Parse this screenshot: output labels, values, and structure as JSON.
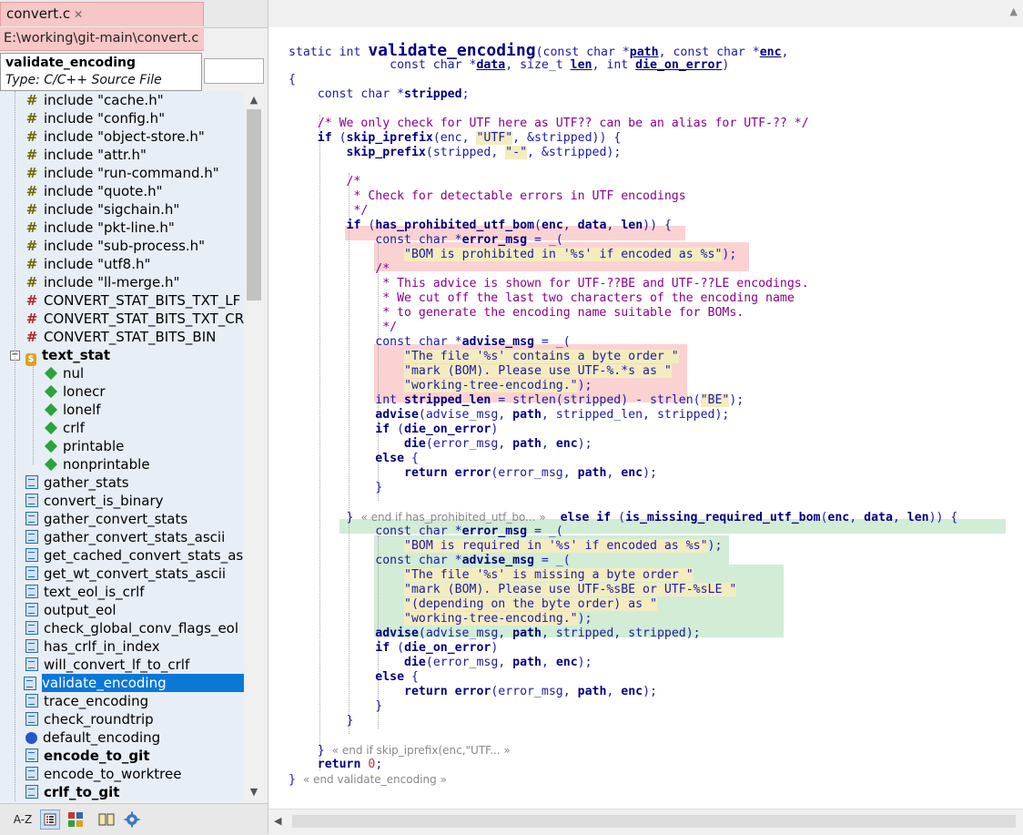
{
  "tab": {
    "title": "convert.c",
    "close": "✕"
  },
  "path": "E:\\working\\git-main\\convert.c",
  "tooltip": {
    "name": "validate_encoding",
    "type": "Type: C/C++ Source File"
  },
  "tree": {
    "rows": [
      {
        "label": "include \"cache.h\"",
        "icon": "include-icon"
      },
      {
        "label": "include \"config.h\"",
        "icon": "include-icon"
      },
      {
        "label": "include \"object-store.h\"",
        "icon": "include-icon"
      },
      {
        "label": "include \"attr.h\"",
        "icon": "include-icon"
      },
      {
        "label": "include \"run-command.h\"",
        "icon": "include-icon"
      },
      {
        "label": "include \"quote.h\"",
        "icon": "include-icon"
      },
      {
        "label": "include \"sigchain.h\"",
        "icon": "include-icon"
      },
      {
        "label": "include \"pkt-line.h\"",
        "icon": "include-icon"
      },
      {
        "label": "include \"sub-process.h\"",
        "icon": "include-icon"
      },
      {
        "label": "include \"utf8.h\"",
        "icon": "include-icon"
      },
      {
        "label": "include \"ll-merge.h\"",
        "icon": "include-icon"
      },
      {
        "label": "CONVERT_STAT_BITS_TXT_LF",
        "icon": "define-icon"
      },
      {
        "label": "CONVERT_STAT_BITS_TXT_CRLF",
        "icon": "define-icon"
      },
      {
        "label": "CONVERT_STAT_BITS_BIN",
        "icon": "define-icon"
      },
      {
        "label": "text_stat",
        "icon": "struct-icon",
        "bold": true,
        "expander": "−"
      },
      {
        "label": "nul",
        "icon": "member-icon",
        "indent": 1
      },
      {
        "label": "lonecr",
        "icon": "member-icon",
        "indent": 1
      },
      {
        "label": "lonelf",
        "icon": "member-icon",
        "indent": 1
      },
      {
        "label": "crlf",
        "icon": "member-icon",
        "indent": 1
      },
      {
        "label": "printable",
        "icon": "member-icon",
        "indent": 1
      },
      {
        "label": "nonprintable",
        "icon": "member-icon",
        "indent": 1
      },
      {
        "label": "gather_stats",
        "icon": "function-icon"
      },
      {
        "label": "convert_is_binary",
        "icon": "function-icon"
      },
      {
        "label": "gather_convert_stats",
        "icon": "function-icon"
      },
      {
        "label": "gather_convert_stats_ascii",
        "icon": "function-icon"
      },
      {
        "label": "get_cached_convert_stats_ascii",
        "icon": "function-icon"
      },
      {
        "label": "get_wt_convert_stats_ascii",
        "icon": "function-icon"
      },
      {
        "label": "text_eol_is_crlf",
        "icon": "function-icon"
      },
      {
        "label": "output_eol",
        "icon": "function-icon"
      },
      {
        "label": "check_global_conv_flags_eol",
        "icon": "function-icon"
      },
      {
        "label": "has_crlf_in_index",
        "icon": "function-icon"
      },
      {
        "label": "will_convert_lf_to_crlf",
        "icon": "function-icon"
      },
      {
        "label": "validate_encoding",
        "icon": "function-icon",
        "selected": true
      },
      {
        "label": "trace_encoding",
        "icon": "function-icon"
      },
      {
        "label": "check_roundtrip",
        "icon": "function-icon"
      },
      {
        "label": "default_encoding",
        "icon": "global-icon"
      },
      {
        "label": "encode_to_git",
        "icon": "function-icon",
        "bold": true
      },
      {
        "label": "encode_to_worktree",
        "icon": "function-icon"
      },
      {
        "label": "crlf_to_git",
        "icon": "function-icon",
        "bold": true
      }
    ]
  },
  "toolbar": {
    "sort_label": "A-Z"
  },
  "scroll": {
    "up": "▲",
    "down": "▼",
    "left": "◀"
  },
  "code": {
    "lines": [
      {
        "html": "<span class=\"kw\">static int </span><span class=\"fn\" style=\"font-size:18px\">validate_encoding</span><span class=\"kw\">(const char *</span><span class=\"kb ul\">path</span><span class=\"kw\">, const char *</span><span class=\"kb ul\">enc</span><span class=\"kw\">,</span>"
      },
      {
        "html": "              <span class=\"kw\">const char *</span><span class=\"kb ul\">data</span><span class=\"kw\">, size_t </span><span class=\"kb ul\">len</span><span class=\"kw\">, int </span><span class=\"kb ul\">die_on_error</span><span class=\"kw\">)</span>"
      },
      {
        "html": "<span class=\"kw\">{</span>"
      },
      {
        "html": "    <span class=\"kw\">const char *</span><span class=\"kb\">stripped</span><span class=\"kw\">;</span>"
      },
      {
        "html": ""
      },
      {
        "html": "    <span class=\"cm\">/* We only check for UTF here as UTF?? can be an alias for UTF-?? */</span>"
      },
      {
        "html": "    <span class=\"kb\">if</span><span class=\"kw\"> (</span><span class=\"kb\">skip_iprefix</span><span class=\"kw\">(enc, </span><span class=\"st\">\"UTF\"</span><span class=\"kw\">, &amp;stripped)) {</span>"
      },
      {
        "html": "        <span class=\"kb\">skip_prefix</span><span class=\"kw\">(stripped, </span><span class=\"st\">\"-\"</span><span class=\"kw\">, &amp;stripped);</span>"
      },
      {
        "html": ""
      },
      {
        "html": "        <span class=\"cm\">/*</span>"
      },
      {
        "html": "         <span class=\"cm\">* Check for detectable errors in UTF encodings</span>"
      },
      {
        "html": "         <span class=\"cm\">*/</span>"
      },
      {
        "html": "        <span class=\"kb\">if</span><span class=\"kw\"> (</span><span class=\"kb\">has_prohibited_utf_bom</span><span class=\"kw\">(</span><span class=\"kb\">enc</span><span class=\"kw\">, </span><span class=\"kb\">data</span><span class=\"kw\">, </span><span class=\"kb\">len</span><span class=\"kw\">)) {</span>"
      },
      {
        "html": "            <span class=\"kw\">const char *</span><span class=\"kb\">error_msg</span><span class=\"kw\"> = _(</span>"
      },
      {
        "html": "                <span class=\"st\">\"BOM is prohibited in '%s' if encoded as %s\"</span><span class=\"kw\">);</span>"
      },
      {
        "html": "            <span class=\"cm\">/*</span>"
      },
      {
        "html": "             <span class=\"cm\">* This advice is shown for UTF-??BE and UTF-??LE encodings.</span>"
      },
      {
        "html": "             <span class=\"cm\">* We cut off the last two characters of the encoding name</span>"
      },
      {
        "html": "             <span class=\"cm\">* to generate the encoding name suitable for BOMs.</span>"
      },
      {
        "html": "             <span class=\"cm\">*/</span>"
      },
      {
        "html": "            <span class=\"kw\">const char *</span><span class=\"kb\">advise_msg</span><span class=\"kw\"> = _(</span>"
      },
      {
        "html": "                <span class=\"st\">\"The file '%s' contains a byte order \"</span>"
      },
      {
        "html": "                <span class=\"st\">\"mark (BOM). Please use UTF-%.*s as \"</span>"
      },
      {
        "html": "                <span class=\"st\">\"working-tree-encoding.\"</span><span class=\"kw\">);</span>"
      },
      {
        "html": "            <span class=\"kw\">int </span><span class=\"kb\">stripped_len</span><span class=\"kw\"> = strlen(stripped) - strlen(</span><span class=\"st\">\"BE\"</span><span class=\"kw\">);</span>"
      },
      {
        "html": "            <span class=\"kb\">advise</span><span class=\"kw\">(advise_msg, </span><span class=\"kb\">path</span><span class=\"kw\">, stripped_len, stripped);</span>"
      },
      {
        "html": "            <span class=\"kb\">if</span><span class=\"kw\"> (</span><span class=\"kb\">die_on_error</span><span class=\"kw\">)</span>"
      },
      {
        "html": "                <span class=\"kb\">die</span><span class=\"kw\">(error_msg, </span><span class=\"kb\">path</span><span class=\"kw\">, </span><span class=\"kb\">enc</span><span class=\"kw\">);</span>"
      },
      {
        "html": "            <span class=\"kb\">else</span><span class=\"kw\"> {</span>"
      },
      {
        "html": "                <span class=\"kb\">return</span><span class=\"kw\"> </span><span class=\"kb\">error</span><span class=\"kw\">(error_msg, </span><span class=\"kb\">path</span><span class=\"kw\">, </span><span class=\"kb\">enc</span><span class=\"kw\">);</span>"
      },
      {
        "html": "            <span class=\"kw\">}</span>"
      },
      {
        "html": ""
      },
      {
        "html": "        <span class=\"kw\">}</span> <span class=\"fold\">« end if has_prohibited_utf_bo... »</span>  <span class=\"kb\">else if</span><span class=\"kw\"> (</span><span class=\"kb\">is_missing_required_utf_bom</span><span class=\"kw\">(</span><span class=\"kb\">enc</span><span class=\"kw\">, </span><span class=\"kb\">data</span><span class=\"kw\">, </span><span class=\"kb\">len</span><span class=\"kw\">)) {</span>"
      },
      {
        "html": "            <span class=\"kw\">const char *</span><span class=\"kb\">error_msg</span><span class=\"kw\"> = _(</span>"
      },
      {
        "html": "                <span class=\"st\">\"BOM is required in '%s' if encoded as %s\"</span><span class=\"kw\">);</span>"
      },
      {
        "html": "            <span class=\"kw\">const char *</span><span class=\"kb\">advise_msg</span><span class=\"kw\"> = _(</span>"
      },
      {
        "html": "                <span class=\"st\">\"The file '%s' is missing a byte order \"</span>"
      },
      {
        "html": "                <span class=\"st\">\"mark (BOM). Please use UTF-%sBE or UTF-%sLE \"</span>"
      },
      {
        "html": "                <span class=\"st\">\"(depending on the byte order) as \"</span>"
      },
      {
        "html": "                <span class=\"st\">\"working-tree-encoding.\"</span><span class=\"kw\">);</span>"
      },
      {
        "html": "            <span class=\"kb\">advise</span><span class=\"kw\">(advise_msg, </span><span class=\"kb\">path</span><span class=\"kw\">, stripped, stripped);</span>"
      },
      {
        "html": "            <span class=\"kb\">if</span><span class=\"kw\"> (</span><span class=\"kb\">die_on_error</span><span class=\"kw\">)</span>"
      },
      {
        "html": "                <span class=\"kb\">die</span><span class=\"kw\">(error_msg, </span><span class=\"kb\">path</span><span class=\"kw\">, </span><span class=\"kb\">enc</span><span class=\"kw\">);</span>"
      },
      {
        "html": "            <span class=\"kb\">else</span><span class=\"kw\"> {</span>"
      },
      {
        "html": "                <span class=\"kb\">return</span><span class=\"kw\"> </span><span class=\"kb\">error</span><span class=\"kw\">(error_msg, </span><span class=\"kb\">path</span><span class=\"kw\">, </span><span class=\"kb\">enc</span><span class=\"kw\">);</span>"
      },
      {
        "html": "            <span class=\"kw\">}</span>"
      },
      {
        "html": "        <span class=\"kw\">}</span>"
      },
      {
        "html": ""
      },
      {
        "html": "    <span class=\"kw\">}</span> <span class=\"fold\">« end if skip_iprefix(enc,\"UTF... »</span>"
      },
      {
        "html": "    <span class=\"kb\">return</span><span class=\"kw\"> </span><span class=\"num\">0</span><span class=\"kw\">;</span>"
      },
      {
        "html": "<span class=\"kw\">}</span> <span class=\"fold\">« end validate_encoding »</span>"
      }
    ]
  }
}
